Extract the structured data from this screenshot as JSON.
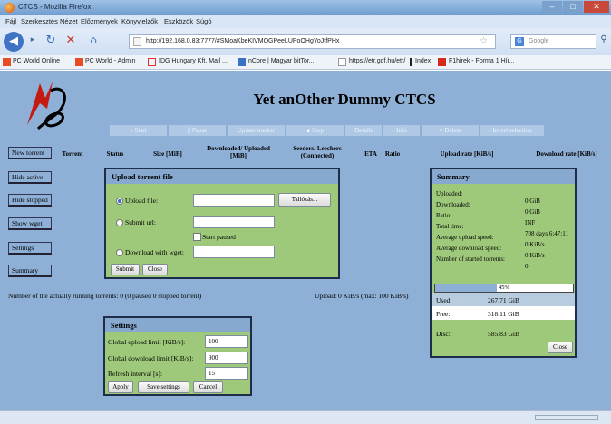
{
  "window": {
    "title": "CTCS - Mozilla Firefox"
  },
  "menu": [
    "Fájl",
    "Szerkesztés",
    "Nézet",
    "Előzmények",
    "Könyvjelzők",
    "Eszközök",
    "Súgó"
  ],
  "nav": {
    "url": "http://192.168.0.83:7777/#SMoaKbeKIVMQGPeeLUPoOHgYoJtfPHx",
    "search_placeholder": "Google"
  },
  "bookmarks": [
    "PC World Online",
    "PC World - Admin",
    "IDG Hungary Kft. Mail ...",
    "nCore | Magyar bitTor...",
    "https://etr.gdf.hu/etr/",
    "Index",
    "F1hirek - Forma 1 Hír..."
  ],
  "colors": {
    "page_bg": "#8fb0d6",
    "panel_bg": "#9ec97a",
    "panel_head": "#87a9cf",
    "title_blue": "#6f9ccf"
  },
  "app": {
    "title": "Yet anOther Dummy CTCS"
  },
  "toolbar": [
    "» Start",
    "∥ Pause",
    "Update tracker",
    "∎ Stop",
    "Details",
    "Info",
    "× Delete",
    "Invert selection"
  ],
  "sidebar": [
    "New torrent",
    "Hide active",
    "Hide stopped",
    "Show wget",
    "Settings",
    "Summary"
  ],
  "columns": [
    "Torrent",
    "Status",
    "Size [MiB]",
    "Downloaded/ Uploaded [MiB]",
    "Seeders/ Leechers (Connected)",
    "ETA",
    "Ratio",
    "Upload rate [KiB/s]",
    "Download rate [KiB/s]"
  ],
  "upload": {
    "title": "Upload torrent file",
    "upload_file": "Upload file:",
    "browse": "Tallózás...",
    "submit_url": "Submit url:",
    "start_paused": "Start paused",
    "download_wget": "Download with wget:",
    "submit": "Submit",
    "close": "Close"
  },
  "summary": {
    "title": "Summary",
    "rows": [
      {
        "label": "Uploaded:",
        "value": "0 GiB"
      },
      {
        "label": "Downloaded:",
        "value": "0 GiB"
      },
      {
        "label": "Ratio:",
        "value": "INF"
      },
      {
        "label": "Total time:",
        "value": "708 days 6:47:11"
      },
      {
        "label": "Average upload speed:",
        "value": "0 KiB/s"
      },
      {
        "label": "Average download speed:",
        "value": "0 KiB/s"
      },
      {
        "label": "Number of started torrents:",
        "value": "0"
      }
    ],
    "disk_percent_text": "45%",
    "disk_fraction": 0.45,
    "used_label": "Used:",
    "used_value": "267.71 GiB",
    "free_label": "Free:",
    "free_value": "318.11 GiB",
    "disc_label": "Disc:",
    "disc_value": "585.83 GiB",
    "close": "Close"
  },
  "status": {
    "running": "Number of the actually running torrents: 0 (0 paused 0 stopped torrent)",
    "upload": "Upload: 0 KiB/s (max: 100 KiB/s)"
  },
  "settings": {
    "title": "Settings",
    "upload_limit_label": "Global upload limit [KiB/s]:",
    "upload_limit_value": "100",
    "download_limit_label": "Global download limit [KiB/s]:",
    "download_limit_value": "900",
    "refresh_label": "Refresh interval [s]:",
    "refresh_value": "15",
    "apply": "Apply",
    "save": "Save settings",
    "cancel": "Cancel"
  }
}
